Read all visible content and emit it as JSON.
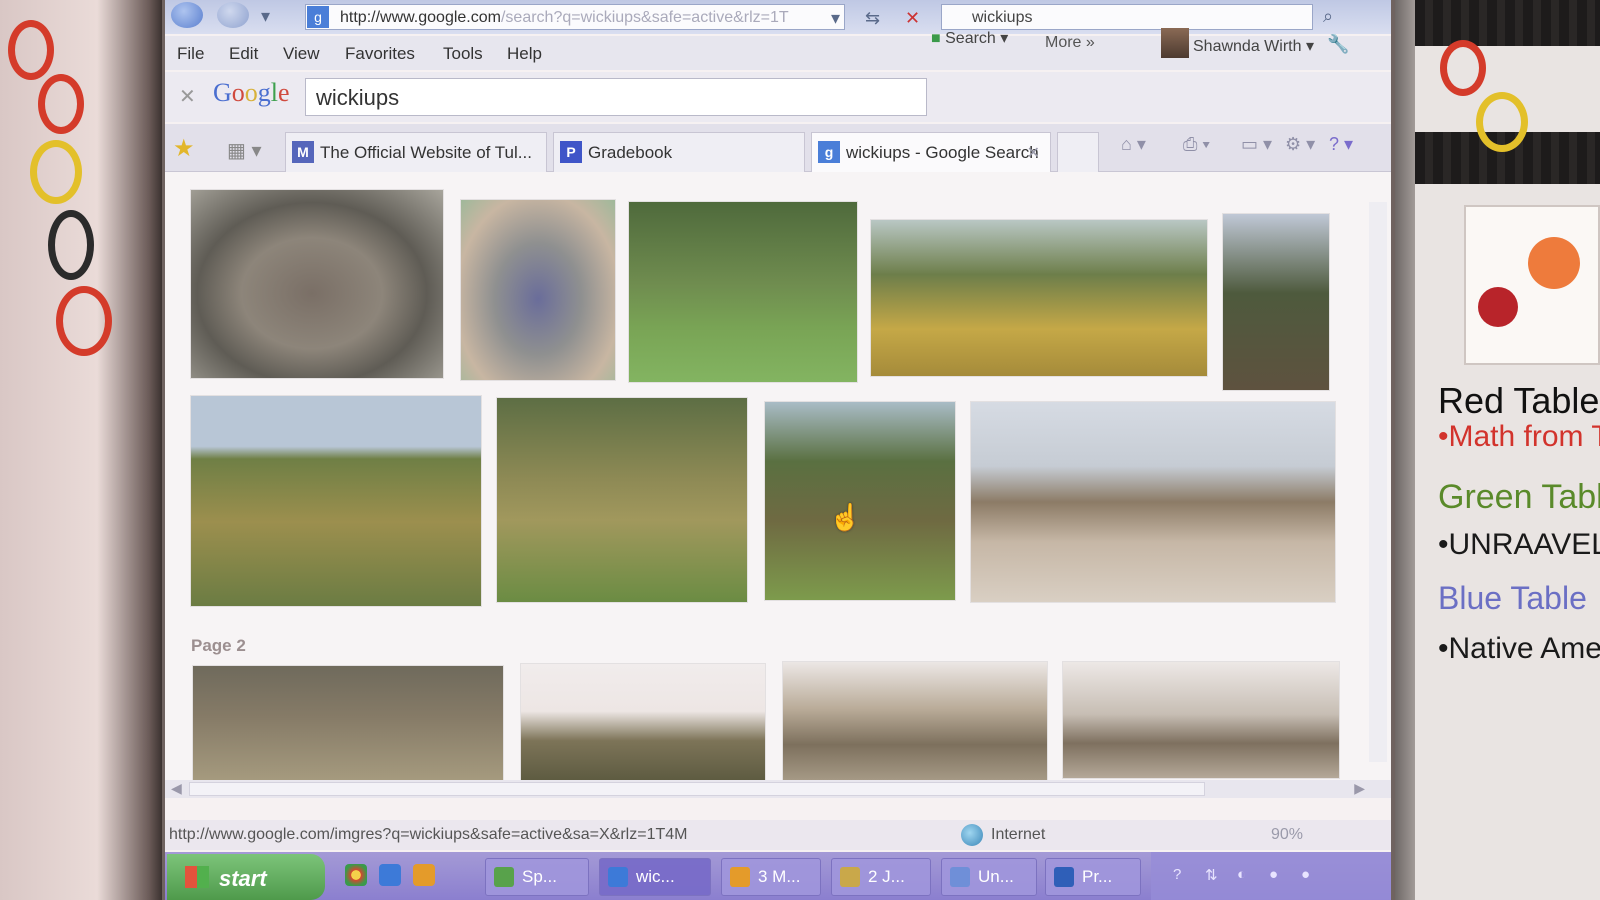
{
  "browser": {
    "url": {
      "domain": "http://www.google.com",
      "path": "/search?q=wickiups&safe=active&rlz=1T"
    },
    "search_box_value": "wickiups",
    "menu": [
      "File",
      "Edit",
      "View",
      "Favorites",
      "Tools",
      "Help"
    ],
    "google_toolbar": {
      "query": "wickiups",
      "search_label": "Search",
      "more_label": "More »",
      "user_name": "Shawnda Wirth"
    },
    "tabs": [
      {
        "label": "The Official Website of Tul...",
        "icon": "school-icon"
      },
      {
        "label": "Gradebook",
        "icon": "p-icon"
      },
      {
        "label": "wickiups - Google Search",
        "icon": "google-icon",
        "active": true
      }
    ],
    "content": {
      "page_label": "Page 2"
    },
    "status": {
      "url": "http://www.google.com/imgres?q=wickiups&safe=active&sa=X&rlz=1T4M",
      "zone": "Internet",
      "zoom": "90%"
    }
  },
  "taskbar": {
    "start_label": "start",
    "tasks": [
      "Sp...",
      "wic...",
      "3 M...",
      "2 J...",
      "Un...",
      "Pr..."
    ]
  },
  "room": {
    "whiteboard": {
      "heading": "Red Table",
      "items": [
        {
          "text": "•Math from To",
          "color": "#d2332c"
        },
        {
          "text": "Green Tabl",
          "color": "#5a8a2a"
        },
        {
          "text": "•UNRAAVEL Sh",
          "color": "#1a1a1a"
        },
        {
          "text": "Blue Table",
          "color": "#6b6fc4"
        },
        {
          "text": "•Native Amer",
          "color": "#1a1a1a"
        }
      ]
    }
  }
}
